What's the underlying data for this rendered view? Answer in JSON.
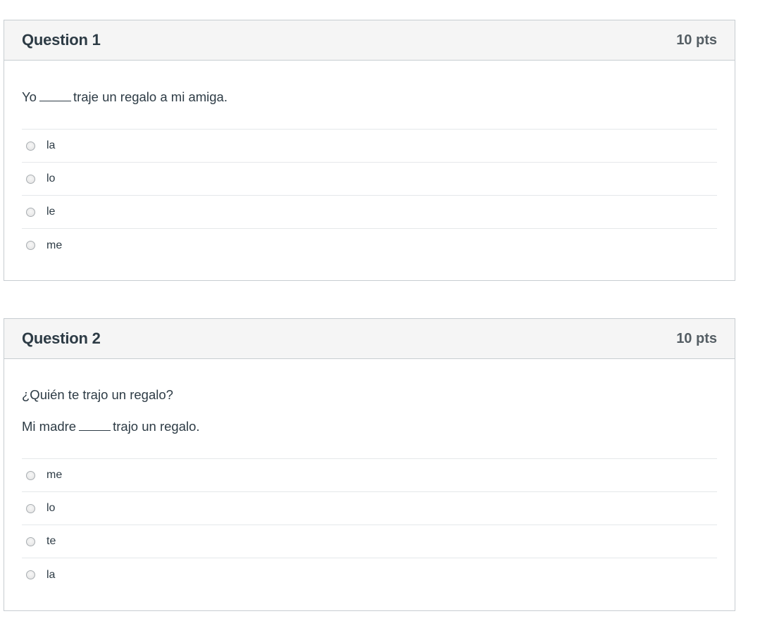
{
  "questions": [
    {
      "title": "Question 1",
      "points": "10 pts",
      "text_before": "Yo",
      "text_after": "traje un regalo a mi amiga.",
      "answers": [
        "la",
        "lo",
        "le",
        "me"
      ]
    },
    {
      "title": "Question 2",
      "points": "10 pts",
      "prompt": "¿Quién te trajo un regalo?",
      "text_before": "Mi madre",
      "text_after": "trajo un regalo.",
      "answers": [
        "me",
        "lo",
        "te",
        "la"
      ]
    }
  ]
}
